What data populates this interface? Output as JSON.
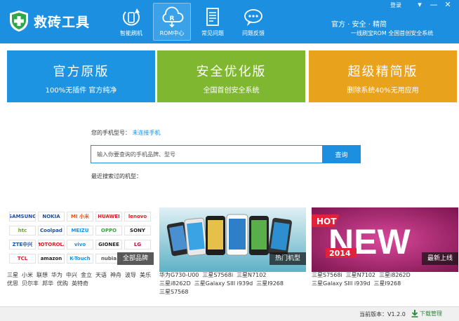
{
  "header": {
    "app_name": "救砖工具",
    "login": "登录",
    "window_controls": [
      "▾",
      "—",
      "✕"
    ],
    "slogan_main": "官方 · 安全 · 精简",
    "slogan_sub": "一线刷宝ROM  全国首创安全系统",
    "brand_color": "#1c8fe0",
    "nav": [
      {
        "label": "智能刷机",
        "icon": "refresh-phone-icon",
        "active": false
      },
      {
        "label": "ROM中心",
        "icon": "cloud-rom-icon",
        "active": true
      },
      {
        "label": "常见问题",
        "icon": "document-icon",
        "active": false
      },
      {
        "label": "问题反馈",
        "icon": "chat-bubble-icon",
        "active": false
      }
    ]
  },
  "banners": [
    {
      "title": "官方原版",
      "subtitle": "100%无插件 官方纯净",
      "color": "#1c94e2"
    },
    {
      "title": "安全优化版",
      "subtitle": "全国首创安全系统",
      "color": "#7fb830"
    },
    {
      "title": "超级精简版",
      "subtitle": "删除系统40%无用应用",
      "color": "#e8a21c"
    }
  ],
  "search": {
    "model_label": "您的手机型号：",
    "model_value": "未连接手机",
    "placeholder": "输入你要查询的手机品牌、型号",
    "button": "查询",
    "recent_label": "最近搜索过的机型："
  },
  "panels": [
    {
      "tag": "全部品牌",
      "brands": [
        {
          "name": "SAMSUNG",
          "color": "#1f4ea1"
        },
        {
          "name": "NOKIA",
          "color": "#1f4ea1"
        },
        {
          "name": "MI 小米",
          "color": "#e8561c"
        },
        {
          "name": "HUAWEI",
          "color": "#d81e1e"
        },
        {
          "name": "lenovo",
          "color": "#d81e1e"
        },
        {
          "name": "htc",
          "color": "#6aa51d"
        },
        {
          "name": "Coolpad",
          "color": "#1f4ea1"
        },
        {
          "name": "MEIZU",
          "color": "#1c8fe0"
        },
        {
          "name": "OPPO",
          "color": "#3aa23a"
        },
        {
          "name": "SONY",
          "color": "#222222"
        },
        {
          "name": "ZTE中兴",
          "color": "#1f4ea1"
        },
        {
          "name": "MOTOROLA",
          "color": "#d81e1e"
        },
        {
          "name": "vivo",
          "color": "#1c8fe0"
        },
        {
          "name": "GIONEE",
          "color": "#222222"
        },
        {
          "name": "LG",
          "color": "#b0123b"
        },
        {
          "name": "TCL",
          "color": "#d81e1e"
        },
        {
          "name": "amazon",
          "color": "#222222"
        },
        {
          "name": "K-Touch",
          "color": "#1c8fe0"
        },
        {
          "name": "nubia",
          "color": "#555555"
        }
      ],
      "links": [
        "三星",
        "小米",
        "联想",
        "华为",
        "中兴",
        "金立",
        "天语",
        "神舟",
        "波导",
        "美乐",
        "优思",
        "贝尔丰",
        "邦华",
        "优购",
        "英特奇"
      ]
    },
    {
      "tag": "热门机型",
      "links": [
        "华为G730-U00",
        "三星S7568i",
        "三星N7102",
        "三星i8262D",
        "三星Galaxy SIII i939d",
        "三星I9268",
        "三星S7568"
      ]
    },
    {
      "tag": "最新上线",
      "badge_hot": "HOT",
      "badge_new": "NEW",
      "badge_year": "2014",
      "links": [
        "三星S7568i",
        "三星N7102",
        "三星i8262D",
        "三星Galaxy SIII i939d",
        "三星I9268"
      ]
    }
  ],
  "footer": {
    "version_label": "当前版本：",
    "version": "V1.2.0",
    "download": "下载管理"
  }
}
